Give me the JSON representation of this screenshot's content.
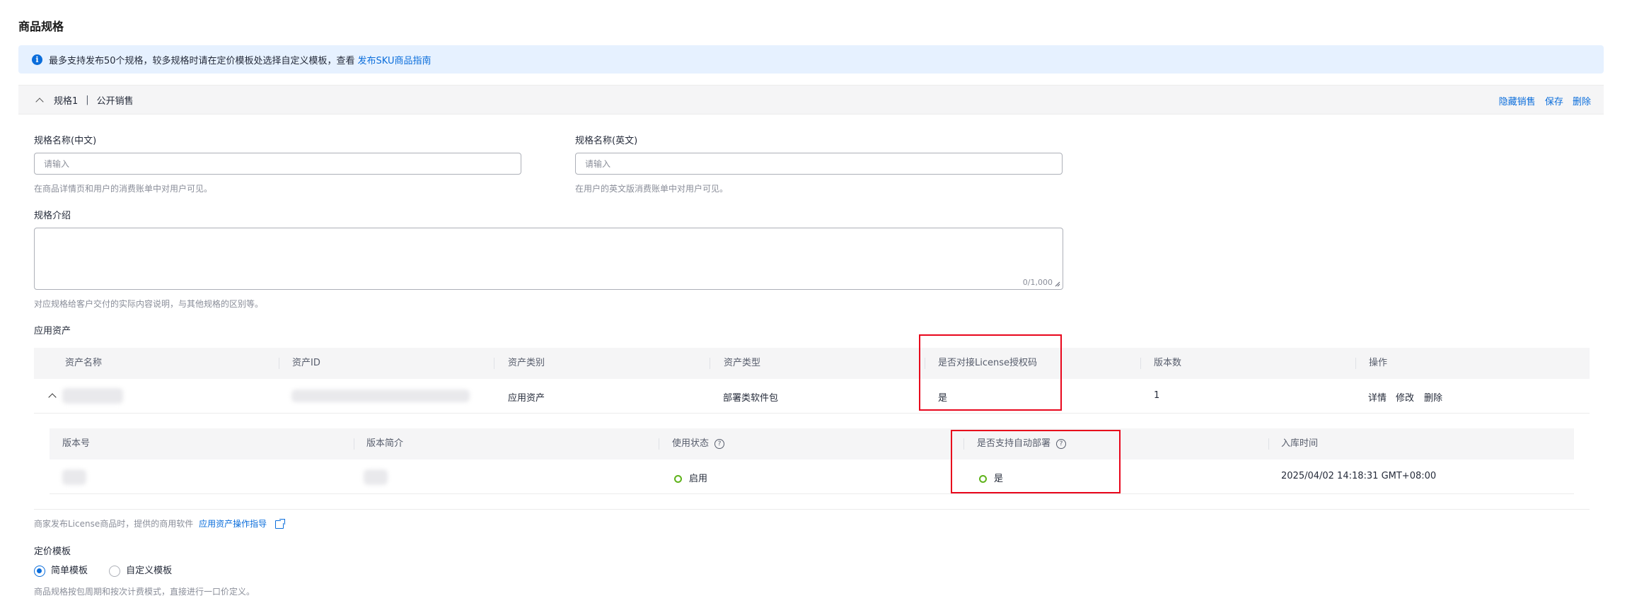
{
  "page_title": "商品规格",
  "notice": {
    "text": "最多支持发布50个规格，较多规格时请在定价模板处选择自定义模板，查看",
    "link": "发布SKU商品指南"
  },
  "spec": {
    "header_name": "规格1",
    "header_sep": "|",
    "header_type": "公开销售",
    "actions": {
      "hide": "隐藏销售",
      "save": "保存",
      "delete": "删除"
    },
    "name_cn": {
      "label": "规格名称(中文)",
      "placeholder": "请输入",
      "help": "在商品详情页和用户的消费账单中对用户可见。"
    },
    "name_en": {
      "label": "规格名称(英文)",
      "placeholder": "请输入",
      "help": "在用户的英文版消费账单中对用户可见。"
    },
    "intro": {
      "label": "规格介绍",
      "counter": "0/1,000",
      "help": "对应规格给客户交付的实际内容说明，与其他规格的区别等。"
    }
  },
  "assets": {
    "label": "应用资产",
    "columns": [
      "资产名称",
      "资产ID",
      "资产类别",
      "资产类型",
      "是否对接License授权码",
      "版本数",
      "操作"
    ],
    "row": {
      "category": "应用资产",
      "type": "部署类软件包",
      "license": "是",
      "versions": "1",
      "actions": {
        "detail": "详情",
        "edit": "修改",
        "delete": "删除"
      }
    },
    "version_table": {
      "columns": [
        "版本号",
        "版本简介",
        "使用状态",
        "是否支持自动部署",
        "入库时间"
      ],
      "row": {
        "status": "启用",
        "auto_deploy": "是",
        "time": "2025/04/02 14:18:31 GMT+08:00"
      }
    },
    "footer_text": "商家发布License商品时，提供的商用软件",
    "footer_link": "应用资产操作指导"
  },
  "pricing": {
    "label": "定价模板",
    "options": [
      "简单模板",
      "自定义模板"
    ],
    "selected": "简单模板",
    "help": "商品规格按包周期和按次计费模式，直接进行一口价定义。"
  },
  "colors": {
    "accent": "#0a6ddb",
    "highlight": "#e8061c",
    "status_ok": "#5fb31b"
  },
  "icons": [
    "info-icon",
    "chevron-up-icon",
    "question-icon",
    "external-link-icon",
    "resize-handle-icon"
  ]
}
